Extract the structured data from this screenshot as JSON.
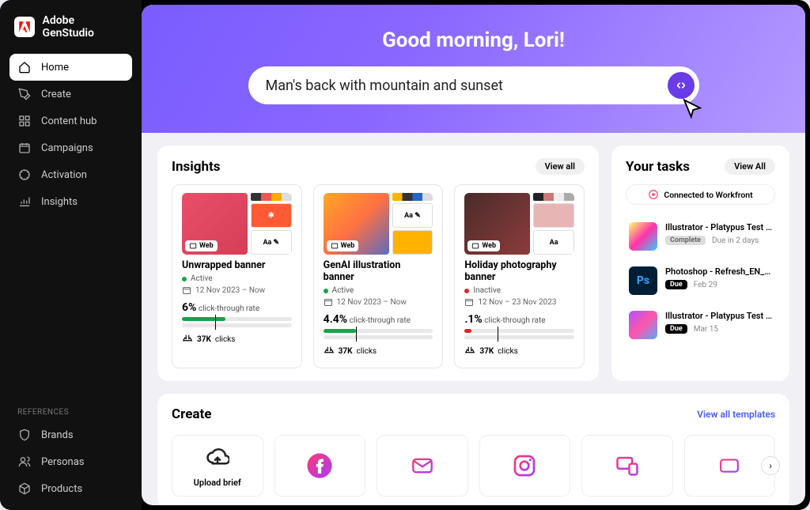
{
  "brand": {
    "name": "Adobe GenStudio"
  },
  "sidebar": {
    "items": [
      {
        "label": "Home"
      },
      {
        "label": "Create"
      },
      {
        "label": "Content hub"
      },
      {
        "label": "Campaigns"
      },
      {
        "label": "Activation"
      },
      {
        "label": "Insights"
      }
    ],
    "ref_header": "REFERENCES",
    "refs": [
      {
        "label": "Brands"
      },
      {
        "label": "Personas"
      },
      {
        "label": "Products"
      }
    ]
  },
  "hero": {
    "greeting": "Good morning, Lori!",
    "search_value": "Man's back with mountain and sunset"
  },
  "insights": {
    "title": "Insights",
    "view_all": "View all",
    "cards": [
      {
        "tag": "Web",
        "title": "Unwrapped banner",
        "status": "Active",
        "status_color": "green",
        "dates": "12 Nov 2023 – Now",
        "metric_value": "6%",
        "metric_label": "click-through rate",
        "clicks_value": "37K",
        "clicks_label": "clicks"
      },
      {
        "tag": "Web",
        "title": "GenAI illustration banner",
        "status": "Active",
        "status_color": "green",
        "dates": "12 Nov 2023 – Now",
        "metric_value": "4.4%",
        "metric_label": "click-through rate",
        "clicks_value": "37K",
        "clicks_label": "clicks"
      },
      {
        "tag": "Web",
        "title": "Holiday photography banner",
        "status": "Inactive",
        "status_color": "red",
        "dates": "12 Nov – 23 Nov 2023",
        "metric_value": ".1%",
        "metric_label": "click-through rate",
        "clicks_value": "37K",
        "clicks_label": "clicks"
      }
    ]
  },
  "tasks": {
    "title": "Your tasks",
    "view_all": "View All",
    "connected": "Connected to Workfront",
    "items": [
      {
        "title": "Illustrator - Platypus Test - Text...",
        "badge": "Complete",
        "badge_kind": "complete",
        "date": "Due in 2 days"
      },
      {
        "title": "Photoshop - Refresh_EN_US",
        "badge": "Due",
        "badge_kind": "due",
        "date": "Feb 29"
      },
      {
        "title": "Illustrator - Platypus Test - Text...",
        "badge": "Due",
        "badge_kind": "due",
        "date": "Mar 15"
      }
    ]
  },
  "create": {
    "title": "Create",
    "view_all": "View all templates",
    "upload_label": "Upload brief"
  }
}
